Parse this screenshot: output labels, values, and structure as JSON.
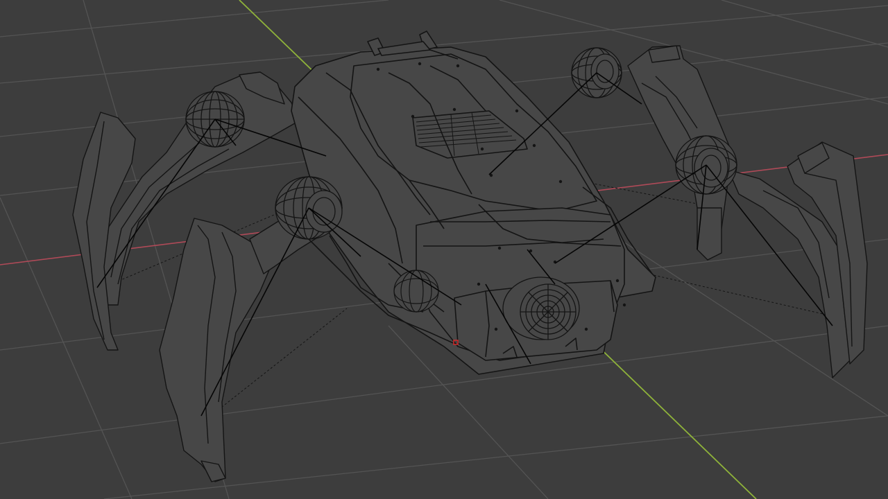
{
  "viewport": {
    "background_color": "#3d3d3d",
    "shading_mode": "wireframe",
    "object": "spider-robot-mesh",
    "colors": {
      "grid": "#545454",
      "x_axis": "#b04a58",
      "y_axis": "#8fb33a",
      "wire": "#141414",
      "mesh_fill": "#474747",
      "bone": "#050505",
      "origin": "#d32a2a"
    }
  }
}
